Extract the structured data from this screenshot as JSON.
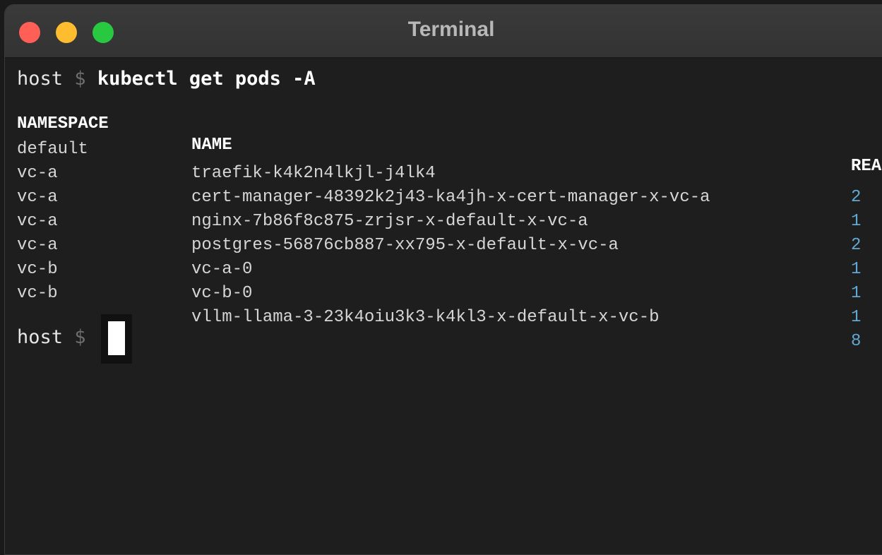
{
  "window": {
    "title": "Terminal"
  },
  "prompt": {
    "host": "host",
    "symbol": "$",
    "command": "kubectl get pods -A"
  },
  "table": {
    "headers": {
      "namespace": "NAMESPACE",
      "name": "NAME",
      "ready": "REA"
    },
    "rows": [
      {
        "namespace": "default",
        "name": "traefik-k4k2n4lkjl-j4lk4",
        "ready": "2"
      },
      {
        "namespace": "vc-a",
        "name": "cert-manager-48392k2j43-ka4jh-x-cert-manager-x-vc-a",
        "ready": "1"
      },
      {
        "namespace": "vc-a",
        "name": "nginx-7b86f8c875-zrjsr-x-default-x-vc-a",
        "ready": "2"
      },
      {
        "namespace": "vc-a",
        "name": "postgres-56876cb887-xx795-x-default-x-vc-a",
        "ready": "1"
      },
      {
        "namespace": "vc-a",
        "name": "vc-a-0",
        "ready": "1"
      },
      {
        "namespace": "vc-b",
        "name": "vc-b-0",
        "ready": "1"
      },
      {
        "namespace": "vc-b",
        "name": "vllm-llama-3-23k4oiu3k3-k4kl3-x-default-x-vc-b",
        "ready": "8"
      }
    ]
  },
  "prompt2": {
    "host": "host",
    "symbol": "$"
  },
  "colors": {
    "close": "#ff5f57",
    "minimize": "#febc2e",
    "zoom": "#28c840",
    "ready_value": "#5fa8d3"
  }
}
